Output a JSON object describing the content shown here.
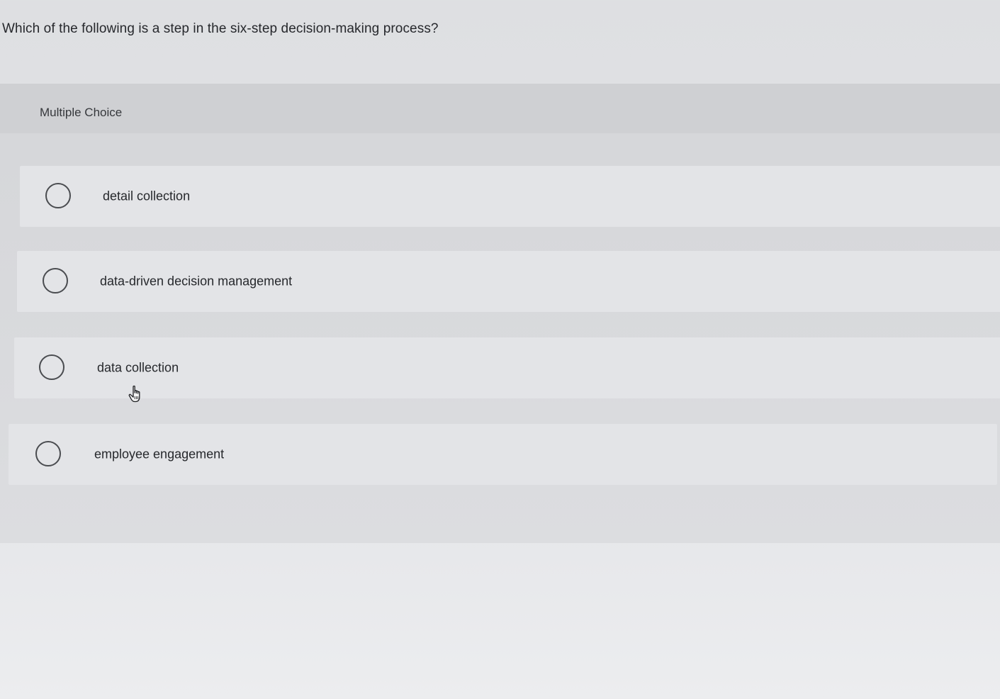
{
  "question": {
    "text": "Which of the following is a step in the six-step decision-making process?"
  },
  "panel": {
    "label": "Multiple Choice"
  },
  "options": [
    {
      "label": "detail collection",
      "selected": false
    },
    {
      "label": "data-driven decision management",
      "selected": false
    },
    {
      "label": "data collection",
      "selected": false
    },
    {
      "label": "employee engagement",
      "selected": false
    }
  ],
  "cursor": {
    "icon": "hand-pointer-icon"
  }
}
